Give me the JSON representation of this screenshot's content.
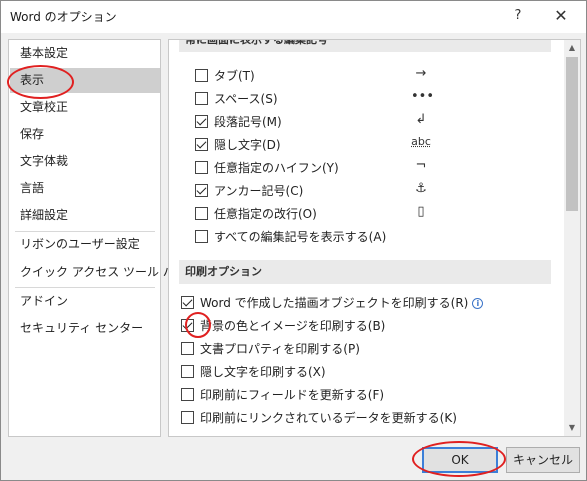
{
  "window": {
    "title": "Word のオプション",
    "help_label": "?",
    "close_label": "✕"
  },
  "nav": {
    "items": [
      {
        "label": "基本設定"
      },
      {
        "label": "表示",
        "selected": true
      },
      {
        "label": "文章校正"
      },
      {
        "label": "保存"
      },
      {
        "label": "文字体裁"
      },
      {
        "label": "言語"
      },
      {
        "label": "詳細設定"
      },
      {
        "label": "リボンのユーザー設定"
      },
      {
        "label": "クイック アクセス ツール バー"
      },
      {
        "label": "アドイン"
      },
      {
        "label": "セキュリティ センター"
      }
    ]
  },
  "sections": {
    "formatting_marks": {
      "header": "常に画面に表示する編集記号",
      "options": [
        {
          "label": "タブ(T)",
          "checked": false,
          "symbol": "→"
        },
        {
          "label": "スペース(S)",
          "checked": false,
          "symbol": "•••"
        },
        {
          "label": "段落記号(M)",
          "checked": true,
          "symbol": "↲"
        },
        {
          "label": "隠し文字(D)",
          "checked": true,
          "symbol": "abc"
        },
        {
          "label": "任意指定のハイフン(Y)",
          "checked": false,
          "symbol": "¬"
        },
        {
          "label": "アンカー記号(C)",
          "checked": true,
          "symbol": "⚓"
        },
        {
          "label": "任意指定の改行(O)",
          "checked": false,
          "symbol": "▯"
        },
        {
          "label": "すべての編集記号を表示する(A)",
          "checked": false,
          "symbol": ""
        }
      ]
    },
    "print_options": {
      "header": "印刷オプション",
      "options": [
        {
          "label": "Word で作成した描画オブジェクトを印刷する(R)",
          "checked": true,
          "info": true
        },
        {
          "label": "背景の色とイメージを印刷する(B)",
          "checked": true
        },
        {
          "label": "文書プロパティを印刷する(P)",
          "checked": false
        },
        {
          "label": "隠し文字を印刷する(X)",
          "checked": false
        },
        {
          "label": "印刷前にフィールドを更新する(F)",
          "checked": false
        },
        {
          "label": "印刷前にリンクされているデータを更新する(K)",
          "checked": false
        }
      ]
    }
  },
  "buttons": {
    "ok": "OK",
    "cancel": "キャンセル"
  },
  "icons": {
    "scroll_up": "▲",
    "scroll_down": "▼",
    "info": "i"
  },
  "colors": {
    "annotation_red": "#e02020",
    "ok_border": "#3c7fd8",
    "selected_nav": "#cfcfcf"
  }
}
